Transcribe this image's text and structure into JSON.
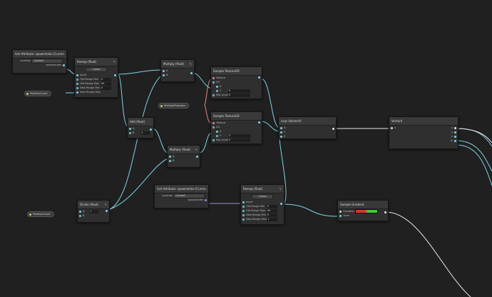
{
  "theme": {
    "background": "#202020",
    "wire_cyan": "#7fd3e6",
    "wire_red": "#e08a8a",
    "wire_white": "#e0e0e0",
    "wire_purple": "#9a8ce0"
  },
  "nodes": {
    "get_attr_1": {
      "title": "Get Attribute: spawnIndex (Current)",
      "location_label": "Location",
      "location_value": "Current",
      "output": "spawnIndex"
    },
    "remap_1": {
      "title": "Remap (float)",
      "clamp": "Clamp",
      "inputs": [
        "Input",
        "Old Range Min",
        "Old Range Max",
        "New Range Min",
        "New Range Max"
      ],
      "values": [
        "0",
        "64",
        "0",
        ""
      ]
    },
    "position_count_1": {
      "label": "PositionCount"
    },
    "multiply_1": {
      "title": "Multiply (float)",
      "inputs": [
        "A",
        "B"
      ]
    },
    "multiple_positions": {
      "label": "MultiplePositions"
    },
    "sample_tex_1": {
      "title": "Sample Texture2D",
      "inputs": [
        "Texture",
        "UV",
        "X",
        "Y",
        "Mip Level"
      ],
      "values": [
        "0",
        "0"
      ]
    },
    "add_1": {
      "title": "Add (float)",
      "inputs": [
        "A",
        "B"
      ],
      "values": [
        "",
        "1"
      ]
    },
    "multiply_2": {
      "title": "Multiply (float)",
      "inputs": [
        "A",
        "B"
      ]
    },
    "sample_tex_2": {
      "title": "Sample Texture2D",
      "inputs": [
        "Texture",
        "UV",
        "X",
        "Y",
        "Mip Level"
      ],
      "values": [
        "0",
        "0"
      ]
    },
    "lerp": {
      "title": "Lerp (Vector4)",
      "inputs": [
        "X",
        "Y",
        "S"
      ]
    },
    "vector4": {
      "title": "Vector4",
      "inputs": [
        "x"
      ],
      "outputs": [
        "x",
        "y",
        "z",
        "w"
      ]
    },
    "divide": {
      "title": "Divide (float)",
      "inputs": [
        "A",
        "B"
      ],
      "values": [
        "",
        "1"
      ]
    },
    "position_count_2": {
      "label": "PositionCount"
    },
    "get_attr_2": {
      "title": "Get Attribute: spawnIndex (Current)",
      "location_label": "Location",
      "location_value": "Current",
      "output": "spawnIndex"
    },
    "remap_2": {
      "title": "Remap (float)",
      "clamp": "Clamp",
      "inputs": [
        "Input",
        "Old Range Min",
        "Old Range Max",
        "New Range Min",
        "New Range Max"
      ],
      "values": [
        "0",
        "64",
        "0",
        "1"
      ]
    },
    "sample_gradient": {
      "title": "Sample Gradient",
      "inputs": [
        "Gradient",
        "Time"
      ]
    }
  }
}
